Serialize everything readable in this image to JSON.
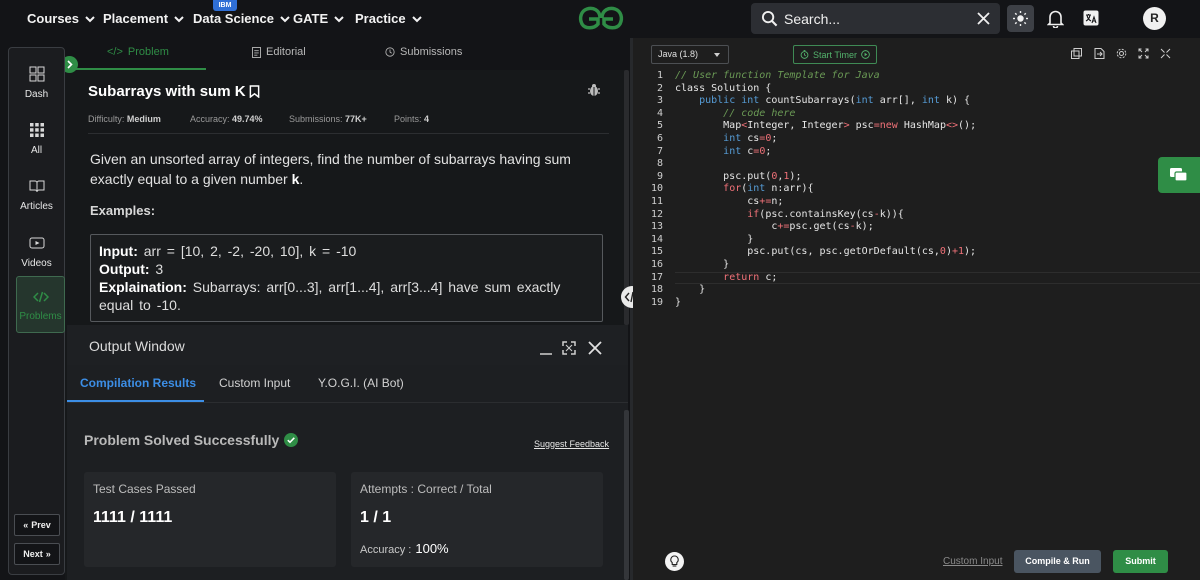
{
  "nav": {
    "items": [
      {
        "label": "Courses"
      },
      {
        "label": "Placement"
      },
      {
        "label": "Data Science"
      },
      {
        "label": "GATE"
      },
      {
        "label": "Practice"
      }
    ],
    "badge": "IBM",
    "search_placeholder": "Search...",
    "avatar_initial": "R"
  },
  "sidebar": {
    "items": [
      {
        "label": "Dash",
        "icon": "dashboard-icon"
      },
      {
        "label": "All",
        "icon": "grid-icon"
      },
      {
        "label": "Articles",
        "icon": "book-icon"
      },
      {
        "label": "Videos",
        "icon": "video-icon"
      },
      {
        "label": "Problems",
        "icon": "code-icon"
      }
    ],
    "prev_label": "Prev",
    "next_label": "Next"
  },
  "problem": {
    "tabs": [
      "Problem",
      "Editorial",
      "Submissions"
    ],
    "title": "Subarrays with sum K",
    "meta": {
      "difficulty_label": "Difficulty:",
      "difficulty": "Medium",
      "accuracy_label": "Accuracy:",
      "accuracy": "49.74%",
      "submissions_label": "Submissions:",
      "submissions": "77K+",
      "points_label": "Points:",
      "points": "4"
    },
    "statement_pre": "Given an unsorted array of integers, find the number of subarrays having sum exactly equal to a given number ",
    "statement_k": "k",
    "statement_post": ".",
    "examples_heading": "Examples:",
    "example": {
      "input_label": "Input:",
      "input": "arr = [10, 2, -2, -20, 10], k = -10",
      "output_label": "Output:",
      "output": "3",
      "explanation_label": "Explaination:",
      "explanation": "Subarrays: arr[0...3], arr[1...4], arr[3...4] have sum exactly equal to -10."
    }
  },
  "output_window": {
    "title": "Output Window",
    "tabs": [
      "Compilation Results",
      "Custom Input",
      "Y.O.G.I. (AI Bot)"
    ],
    "status": "Problem Solved Successfully",
    "feedback_link": "Suggest Feedback",
    "test_cases_label": "Test Cases Passed",
    "test_cases_value": "1111 / 1111",
    "attempts_label": "Attempts : Correct / Total",
    "attempts_value": "1 / 1",
    "accuracy_label": "Accuracy :",
    "accuracy_value": "100%"
  },
  "editor": {
    "language": "Java (1.8)",
    "timer_label": "Start Timer",
    "line_numbers": [
      "1",
      "2",
      "3",
      "4",
      "5",
      "6",
      "7",
      "8",
      "9",
      "10",
      "11",
      "12",
      "13",
      "14",
      "15",
      "16",
      "17",
      "18",
      "19"
    ],
    "custom_input_label": "Custom Input",
    "compile_label": "Compile & Run",
    "submit_label": "Submit"
  },
  "colors": {
    "brand_green": "#2f8d46",
    "accent_blue": "#3c8ee6",
    "bg_dark": "#131417"
  }
}
